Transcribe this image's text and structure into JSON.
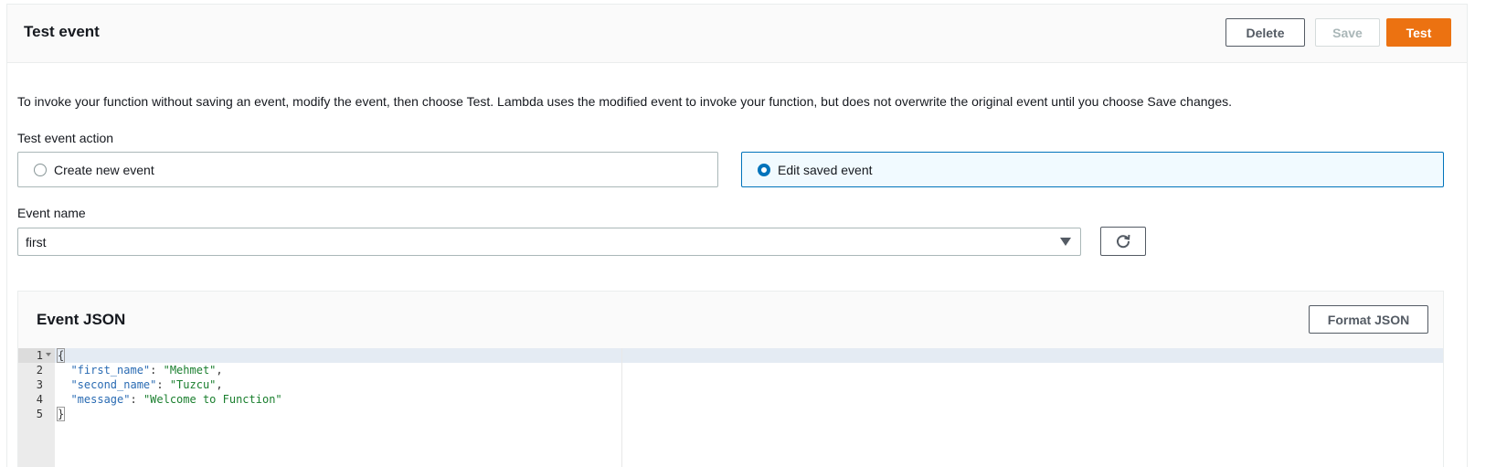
{
  "header": {
    "title": "Test event",
    "delete_label": "Delete",
    "save_label": "Save",
    "test_label": "Test"
  },
  "description": "To invoke your function without saving an event, modify the event, then choose Test. Lambda uses the modified event to invoke your function, but does not overwrite the original event until you choose Save changes.",
  "test_event_action": {
    "label": "Test event action",
    "options": [
      {
        "label": "Create new event",
        "selected": false
      },
      {
        "label": "Edit saved event",
        "selected": true
      }
    ]
  },
  "event_name": {
    "label": "Event name",
    "value": "first"
  },
  "event_json": {
    "title": "Event JSON",
    "format_label": "Format JSON",
    "line_numbers": [
      "1",
      "2",
      "3",
      "4",
      "5"
    ],
    "lines": [
      {
        "open": "{"
      },
      {
        "key": "\"first_name\"",
        "value": "\"Mehmet\"",
        "suffix": ","
      },
      {
        "key": "\"second_name\"",
        "value": "\"Tuzcu\"",
        "suffix": ","
      },
      {
        "key": "\"message\"",
        "value": "\"Welcome to Function\"",
        "suffix": ""
      },
      {
        "close": "}"
      }
    ]
  },
  "colors": {
    "accent": "#ec7211",
    "selected_border": "#0073bb",
    "selected_bg": "#f1faff"
  },
  "icons": {
    "refresh": "refresh-icon",
    "caret": "caret-down-icon",
    "fold": "fold-arrow-icon"
  }
}
